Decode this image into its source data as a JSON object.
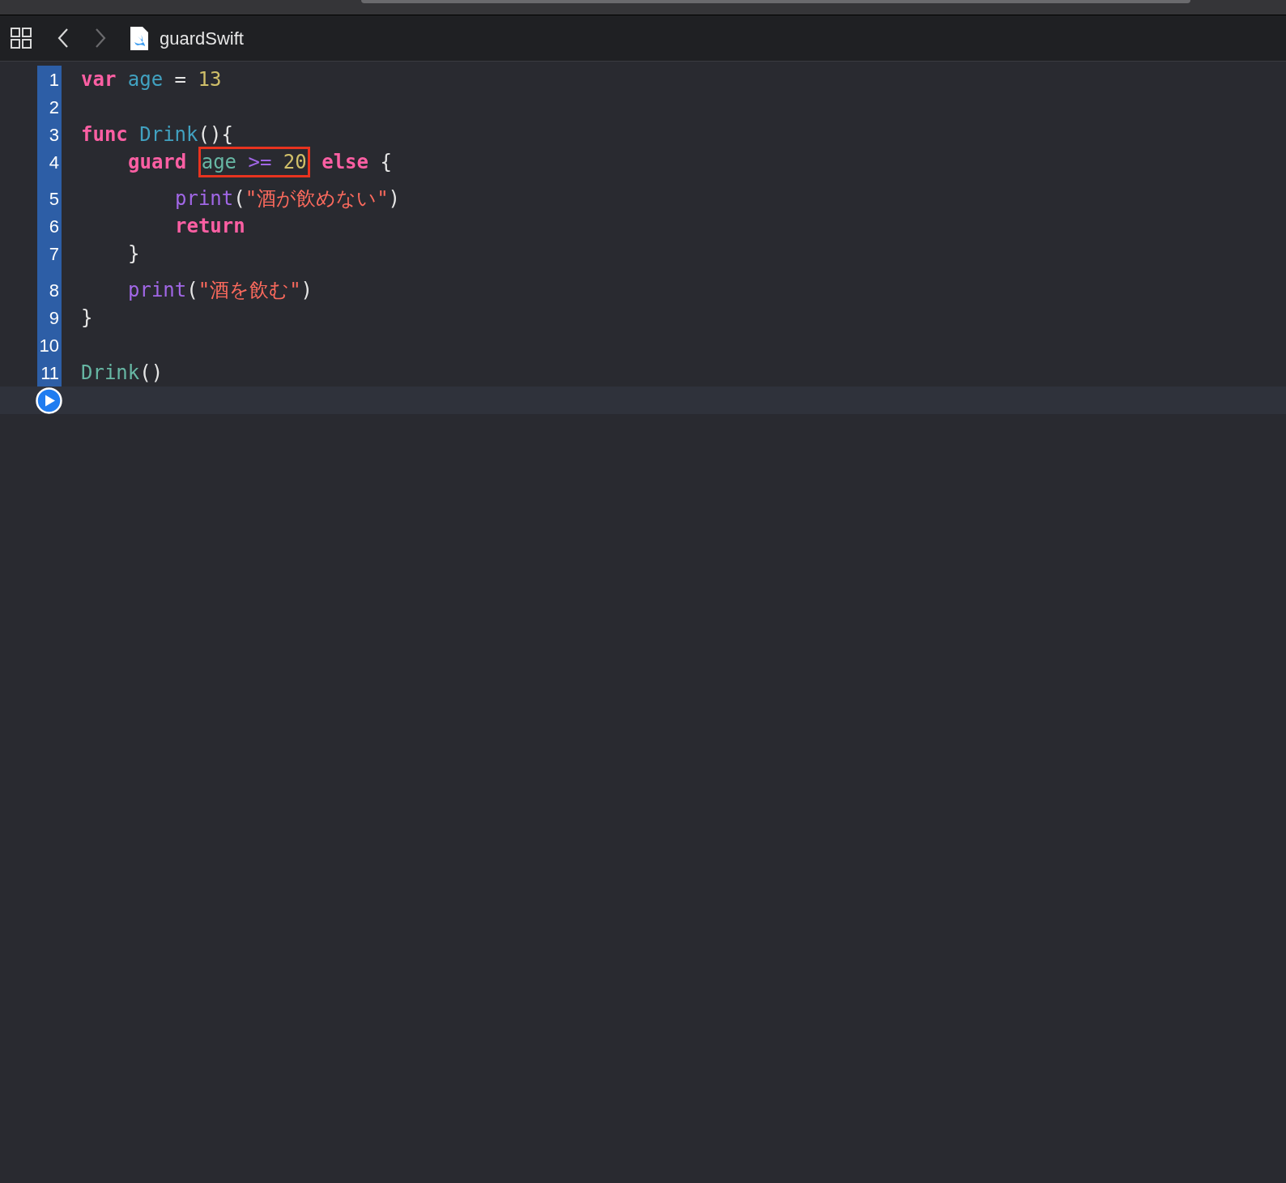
{
  "navigator": {
    "file_name": "guardSwift"
  },
  "editor": {
    "lines": [
      {
        "number": "1",
        "tokens": [
          {
            "kind": "keyword",
            "text": "var "
          },
          {
            "kind": "identifier",
            "text": "age"
          },
          {
            "kind": "plain",
            "text": " = "
          },
          {
            "kind": "number",
            "text": "13"
          }
        ]
      },
      {
        "number": "2"
      },
      {
        "number": "3",
        "tokens": [
          {
            "kind": "keyword",
            "text": "func "
          },
          {
            "kind": "identifier",
            "text": "Drink"
          },
          {
            "kind": "plain",
            "text": "(){"
          }
        ],
        "children": [
          {
            "number": "4",
            "tokens": [
              {
                "kind": "keyword",
                "text": "guard "
              },
              {
                "kind": "annotation_box",
                "tokens": [
                  {
                    "kind": "variable",
                    "text": "age"
                  },
                  {
                    "kind": "operator",
                    "text": " >= "
                  },
                  {
                    "kind": "number",
                    "text": "20"
                  }
                ]
              },
              {
                "kind": "keyword",
                "text": " else"
              },
              {
                "kind": "plain",
                "text": " {"
              }
            ],
            "children": [
              {
                "number": "5",
                "tokens": [
                  {
                    "kind": "call",
                    "text": "print"
                  },
                  {
                    "kind": "plain",
                    "text": "("
                  },
                  {
                    "kind": "string",
                    "text": "\"酒が飲めない\""
                  },
                  {
                    "kind": "plain",
                    "text": ")"
                  }
                ]
              },
              {
                "number": "6",
                "tokens": [
                  {
                    "kind": "keyword",
                    "text": "return"
                  }
                ]
              }
            ]
          },
          {
            "number": "7",
            "tokens": [
              {
                "kind": "plain",
                "text": "}"
              }
            ]
          },
          {
            "number": "8",
            "tokens": [
              {
                "kind": "call",
                "text": "print"
              },
              {
                "kind": "plain",
                "text": "("
              },
              {
                "kind": "string",
                "text": "\"酒を飲む\""
              },
              {
                "kind": "plain",
                "text": ")"
              }
            ]
          }
        ]
      },
      {
        "number": "9",
        "tokens": [
          {
            "kind": "plain",
            "text": "}"
          }
        ]
      },
      {
        "number": "10"
      },
      {
        "number": "11",
        "tokens": [
          {
            "kind": "variable",
            "text": "Drink"
          },
          {
            "kind": "plain",
            "text": "()"
          }
        ]
      }
    ]
  }
}
